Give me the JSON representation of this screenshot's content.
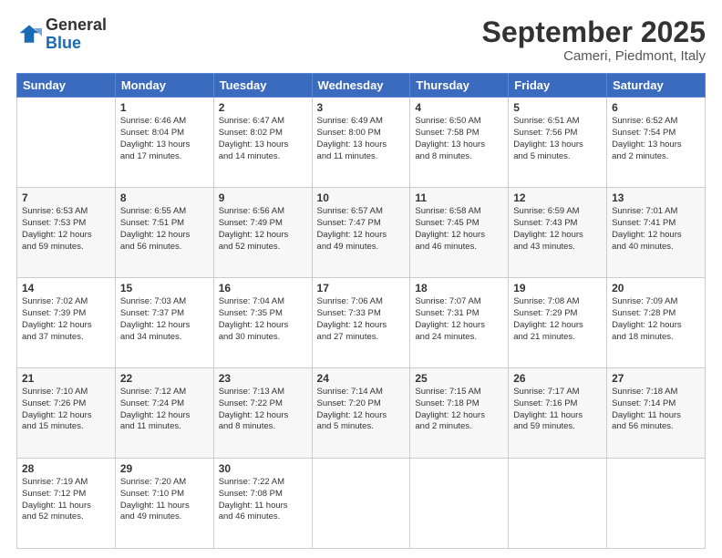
{
  "header": {
    "logo_general": "General",
    "logo_blue": "Blue",
    "month": "September 2025",
    "location": "Cameri, Piedmont, Italy"
  },
  "days_of_week": [
    "Sunday",
    "Monday",
    "Tuesday",
    "Wednesday",
    "Thursday",
    "Friday",
    "Saturday"
  ],
  "weeks": [
    [
      {
        "day": "",
        "info": ""
      },
      {
        "day": "1",
        "info": "Sunrise: 6:46 AM\nSunset: 8:04 PM\nDaylight: 13 hours\nand 17 minutes."
      },
      {
        "day": "2",
        "info": "Sunrise: 6:47 AM\nSunset: 8:02 PM\nDaylight: 13 hours\nand 14 minutes."
      },
      {
        "day": "3",
        "info": "Sunrise: 6:49 AM\nSunset: 8:00 PM\nDaylight: 13 hours\nand 11 minutes."
      },
      {
        "day": "4",
        "info": "Sunrise: 6:50 AM\nSunset: 7:58 PM\nDaylight: 13 hours\nand 8 minutes."
      },
      {
        "day": "5",
        "info": "Sunrise: 6:51 AM\nSunset: 7:56 PM\nDaylight: 13 hours\nand 5 minutes."
      },
      {
        "day": "6",
        "info": "Sunrise: 6:52 AM\nSunset: 7:54 PM\nDaylight: 13 hours\nand 2 minutes."
      }
    ],
    [
      {
        "day": "7",
        "info": "Sunrise: 6:53 AM\nSunset: 7:53 PM\nDaylight: 12 hours\nand 59 minutes."
      },
      {
        "day": "8",
        "info": "Sunrise: 6:55 AM\nSunset: 7:51 PM\nDaylight: 12 hours\nand 56 minutes."
      },
      {
        "day": "9",
        "info": "Sunrise: 6:56 AM\nSunset: 7:49 PM\nDaylight: 12 hours\nand 52 minutes."
      },
      {
        "day": "10",
        "info": "Sunrise: 6:57 AM\nSunset: 7:47 PM\nDaylight: 12 hours\nand 49 minutes."
      },
      {
        "day": "11",
        "info": "Sunrise: 6:58 AM\nSunset: 7:45 PM\nDaylight: 12 hours\nand 46 minutes."
      },
      {
        "day": "12",
        "info": "Sunrise: 6:59 AM\nSunset: 7:43 PM\nDaylight: 12 hours\nand 43 minutes."
      },
      {
        "day": "13",
        "info": "Sunrise: 7:01 AM\nSunset: 7:41 PM\nDaylight: 12 hours\nand 40 minutes."
      }
    ],
    [
      {
        "day": "14",
        "info": "Sunrise: 7:02 AM\nSunset: 7:39 PM\nDaylight: 12 hours\nand 37 minutes."
      },
      {
        "day": "15",
        "info": "Sunrise: 7:03 AM\nSunset: 7:37 PM\nDaylight: 12 hours\nand 34 minutes."
      },
      {
        "day": "16",
        "info": "Sunrise: 7:04 AM\nSunset: 7:35 PM\nDaylight: 12 hours\nand 30 minutes."
      },
      {
        "day": "17",
        "info": "Sunrise: 7:06 AM\nSunset: 7:33 PM\nDaylight: 12 hours\nand 27 minutes."
      },
      {
        "day": "18",
        "info": "Sunrise: 7:07 AM\nSunset: 7:31 PM\nDaylight: 12 hours\nand 24 minutes."
      },
      {
        "day": "19",
        "info": "Sunrise: 7:08 AM\nSunset: 7:29 PM\nDaylight: 12 hours\nand 21 minutes."
      },
      {
        "day": "20",
        "info": "Sunrise: 7:09 AM\nSunset: 7:28 PM\nDaylight: 12 hours\nand 18 minutes."
      }
    ],
    [
      {
        "day": "21",
        "info": "Sunrise: 7:10 AM\nSunset: 7:26 PM\nDaylight: 12 hours\nand 15 minutes."
      },
      {
        "day": "22",
        "info": "Sunrise: 7:12 AM\nSunset: 7:24 PM\nDaylight: 12 hours\nand 11 minutes."
      },
      {
        "day": "23",
        "info": "Sunrise: 7:13 AM\nSunset: 7:22 PM\nDaylight: 12 hours\nand 8 minutes."
      },
      {
        "day": "24",
        "info": "Sunrise: 7:14 AM\nSunset: 7:20 PM\nDaylight: 12 hours\nand 5 minutes."
      },
      {
        "day": "25",
        "info": "Sunrise: 7:15 AM\nSunset: 7:18 PM\nDaylight: 12 hours\nand 2 minutes."
      },
      {
        "day": "26",
        "info": "Sunrise: 7:17 AM\nSunset: 7:16 PM\nDaylight: 11 hours\nand 59 minutes."
      },
      {
        "day": "27",
        "info": "Sunrise: 7:18 AM\nSunset: 7:14 PM\nDaylight: 11 hours\nand 56 minutes."
      }
    ],
    [
      {
        "day": "28",
        "info": "Sunrise: 7:19 AM\nSunset: 7:12 PM\nDaylight: 11 hours\nand 52 minutes."
      },
      {
        "day": "29",
        "info": "Sunrise: 7:20 AM\nSunset: 7:10 PM\nDaylight: 11 hours\nand 49 minutes."
      },
      {
        "day": "30",
        "info": "Sunrise: 7:22 AM\nSunset: 7:08 PM\nDaylight: 11 hours\nand 46 minutes."
      },
      {
        "day": "",
        "info": ""
      },
      {
        "day": "",
        "info": ""
      },
      {
        "day": "",
        "info": ""
      },
      {
        "day": "",
        "info": ""
      }
    ]
  ]
}
